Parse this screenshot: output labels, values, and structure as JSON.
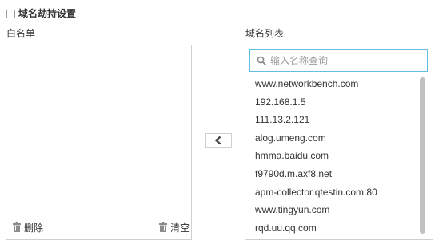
{
  "hijack": {
    "checkbox_label": "域名劫持设置",
    "checked": false
  },
  "whitelist": {
    "title": "白名单",
    "delete_label": "删除",
    "clear_label": "清空"
  },
  "transfer": {
    "icon": "chevron-left-icon"
  },
  "domain_list": {
    "title": "域名列表",
    "search_placeholder": "输入名称查询",
    "search_value": "",
    "items": [
      "www.networkbench.com",
      "192.168.1.5",
      "111.13.2.121",
      "alog.umeng.com",
      "hmma.baidu.com",
      "f9790d.m.axf8.net",
      "apm-collector.qtestin.com:80",
      "www.tingyun.com",
      "rqd.uu.qq.com"
    ]
  },
  "colors": {
    "text": "#333333",
    "border": "#cfcfcf",
    "search_focus_border": "#63bde0",
    "placeholder": "#9a9a9a",
    "scrollbar": "#c1c1c1"
  }
}
